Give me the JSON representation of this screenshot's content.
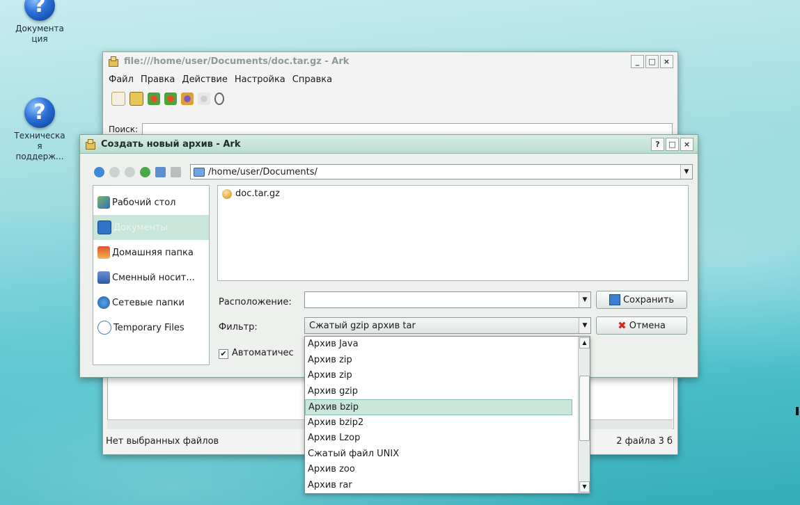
{
  "desktop": {
    "icons": [
      {
        "label_line1": "Документа",
        "label_line2": "ция"
      },
      {
        "label_line1": "Техническа",
        "label_line2": "я",
        "label_line3": "поддерж..."
      }
    ]
  },
  "ark": {
    "title": "file:///home/user/Documents/doc.tar.gz - Ark",
    "menu": [
      "Файл",
      "Правка",
      "Действие",
      "Настройка",
      "Справка"
    ],
    "search_label": "Поиск:",
    "status_left": "Нет выбранных файлов",
    "status_right": "2 файла 3 б"
  },
  "dialog": {
    "title": "Создать новый архив - Ark",
    "path": "/home/user/Documents/",
    "places": [
      {
        "label": "Рабочий стол",
        "icon": "desktop-icon"
      },
      {
        "label": "Документы",
        "icon": "documents-icon"
      },
      {
        "label": "Домашняя папка",
        "icon": "home-icon"
      },
      {
        "label": "Сменный носит...",
        "icon": "removable-media-icon"
      },
      {
        "label": "Сетевые папки",
        "icon": "network-icon"
      },
      {
        "label": "Temporary Files",
        "icon": "temp-folder-icon"
      }
    ],
    "selected_place": "Документы",
    "file": "doc.tar.gz",
    "location_label": "Расположение:",
    "location_value": "",
    "filter_label": "Фильтр:",
    "filter_value": "Сжатый gzip архив tar",
    "auto_ext_label": "Автоматичес",
    "auto_ext_checked": true,
    "save_label": "Сохранить",
    "cancel_label": "Отмена",
    "title_buttons": [
      "?",
      "□",
      "×"
    ]
  },
  "filter_dropdown": {
    "options": [
      "Архив Java",
      "Архив zip",
      "Архив zip",
      "Архив gzip",
      "Архив bzip",
      "Архив bzip2",
      "Архив Lzop",
      "Сжатый файл UNIX",
      "Архив zoo",
      "Архив rar"
    ],
    "highlighted": "Архив bzip"
  },
  "colors": {
    "accent": "#c8e7da",
    "title_gradient": "#b9dccf",
    "desktop": "#4fc2cc"
  }
}
